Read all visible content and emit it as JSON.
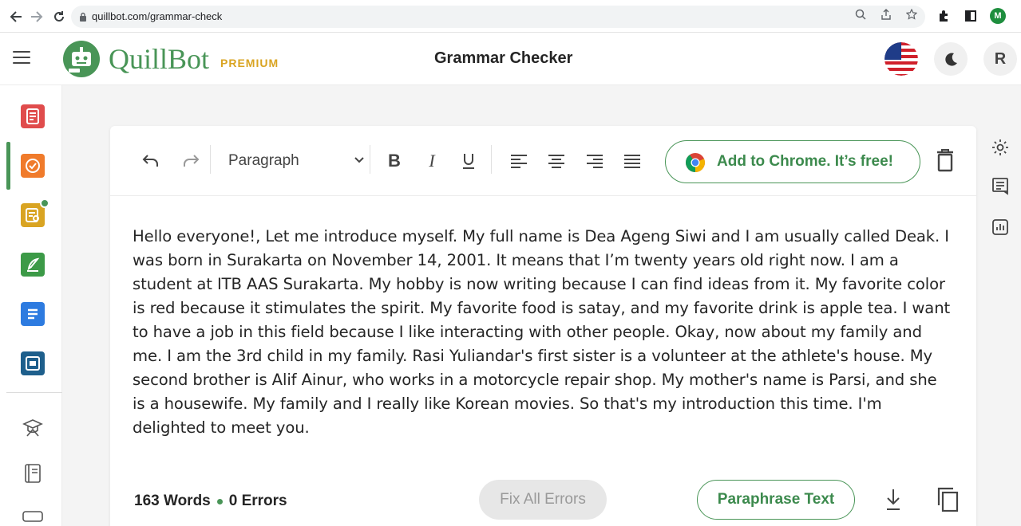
{
  "browser": {
    "url": "quillbot.com/grammar-check",
    "profile_initial": "M"
  },
  "header": {
    "logo_text": "QuillBot",
    "premium_label": "PREMIUM",
    "title": "Grammar Checker",
    "avatar_initial": "R"
  },
  "sidebar": {
    "items": [
      {
        "name": "paraphraser",
        "color": "#e04c4c"
      },
      {
        "name": "grammar-checker",
        "color": "#f07b2b",
        "active": true
      },
      {
        "name": "plagiarism-checker",
        "color": "#d9a422"
      },
      {
        "name": "co-writer",
        "color": "#3c9a47"
      },
      {
        "name": "summarizer",
        "color": "#2d7be0"
      },
      {
        "name": "citation-generator",
        "color": "#1e5f8c"
      },
      {
        "name": "research",
        "icon": "graduation-cap-icon"
      },
      {
        "name": "notebook",
        "icon": "notebook-icon"
      },
      {
        "name": "more",
        "icon": "keyboard-icon"
      }
    ]
  },
  "toolbar": {
    "paragraph_label": "Paragraph",
    "chrome_cta": "Add to Chrome. It’s free!"
  },
  "editor": {
    "text": "Hello everyone!, Let me introduce myself. My full name is Dea Ageng Siwi and I am usually called Deak. I was born in Surakarta on November 14, 2001. It means that I’m twenty years old right now. I am a student at ITB AAS Surakarta. My hobby is now writing because I can find ideas from it. My favorite color is red because it stimulates the spirit. My favorite food is satay, and my favorite drink is apple tea. I want to have a job in this field because I like interacting with other people. Okay, now about my family and me. I am the 3rd child in my family. Rasi Yuliandar's first sister is a volunteer at the athlete's house. My second brother is Alif Ainur, who works in a motorcycle repair shop. My mother's name is Parsi, and she is a housewife. My family and I really like Korean movies. So that's my introduction this time. I'm delighted to meet you."
  },
  "footer": {
    "words": "163 Words",
    "errors": "0 Errors",
    "fix_all_label": "Fix All Errors",
    "paraphrase_label": "Paraphrase Text"
  },
  "colors": {
    "brand_green": "#499557",
    "premium_gold": "#d9a422"
  }
}
